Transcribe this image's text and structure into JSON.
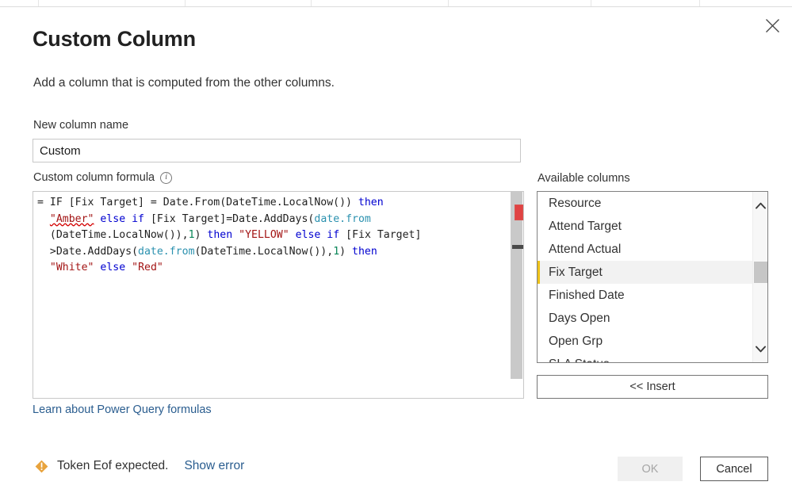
{
  "dialog": {
    "title": "Custom Column",
    "subtitle": "Add a column that is computed from the other columns.",
    "close_icon": "close-icon"
  },
  "new_column": {
    "label": "New column name",
    "value": "Custom",
    "placeholder": ""
  },
  "formula": {
    "label": "Custom column formula",
    "info_icon": "info-icon",
    "info_glyph": "i",
    "text": "= IF [Fix Target] = Date.From(DateTime.LocalNow()) then \"Amber\" else if [Fix Target]=Date.AddDays(date.from(DateTime.LocalNow()),1) then \"YELLOW\" else if [Fix Target]>Date.AddDays(date.from(DateTime.LocalNow()),1) then \"White\" else \"Red\"",
    "tokens": [
      {
        "t": "= IF [Fix Target] = Date.From(DateTime.LocalNow()) ",
        "c": "tok-fn"
      },
      {
        "t": "then",
        "c": "tok-kw"
      },
      {
        "t": "\n  ",
        "c": "tok-fn"
      },
      {
        "t": "\"Amber\"",
        "c": "tok-str misspell"
      },
      {
        "t": " ",
        "c": "tok-fn"
      },
      {
        "t": "else if",
        "c": "tok-kw"
      },
      {
        "t": " [Fix Target]=Date.AddDays(",
        "c": "tok-fn"
      },
      {
        "t": "date.from",
        "c": "tok-id"
      },
      {
        "t": "\n  (DateTime.LocalNow()),",
        "c": "tok-fn"
      },
      {
        "t": "1",
        "c": "tok-num"
      },
      {
        "t": ") ",
        "c": "tok-fn"
      },
      {
        "t": "then",
        "c": "tok-kw"
      },
      {
        "t": " ",
        "c": "tok-fn"
      },
      {
        "t": "\"YELLOW\"",
        "c": "tok-str"
      },
      {
        "t": " ",
        "c": "tok-fn"
      },
      {
        "t": "else if",
        "c": "tok-kw"
      },
      {
        "t": " [Fix Target]\n  >Date.AddDays(",
        "c": "tok-fn"
      },
      {
        "t": "date.from",
        "c": "tok-id"
      },
      {
        "t": "(DateTime.LocalNow()),",
        "c": "tok-fn"
      },
      {
        "t": "1",
        "c": "tok-num"
      },
      {
        "t": ") ",
        "c": "tok-fn"
      },
      {
        "t": "then",
        "c": "tok-kw"
      },
      {
        "t": "\n  ",
        "c": "tok-fn"
      },
      {
        "t": "\"White\"",
        "c": "tok-str"
      },
      {
        "t": " ",
        "c": "tok-fn"
      },
      {
        "t": "else",
        "c": "tok-kw"
      },
      {
        "t": " ",
        "c": "tok-fn"
      },
      {
        "t": "\"Red\"",
        "c": "tok-str"
      }
    ],
    "scrollbar": {
      "error_marker_color": "#e04343",
      "track_color": "#c9c9c9",
      "thumb_color": "#4a4a4a"
    }
  },
  "learn_link": {
    "label": "Learn about Power Query formulas",
    "color": "#2a5d8f"
  },
  "available_columns": {
    "label": "Available columns",
    "items": [
      {
        "label": "Resource",
        "selected": false
      },
      {
        "label": "Attend Target",
        "selected": false
      },
      {
        "label": "Attend Actual",
        "selected": false
      },
      {
        "label": "Fix Target",
        "selected": true
      },
      {
        "label": "Finished Date",
        "selected": false
      },
      {
        "label": "Days Open",
        "selected": false
      },
      {
        "label": "Open Grp",
        "selected": false
      },
      {
        "label": "SLA Status",
        "selected": false
      }
    ],
    "selection_accent_color": "#eec218",
    "scroll_up_icon": "chevron-up-icon",
    "scroll_down_icon": "chevron-down-icon"
  },
  "insert_button": {
    "label": "<< Insert"
  },
  "footer": {
    "warning_icon": "warning-diamond-icon",
    "warning_color": "#e8a33d",
    "error_text": "Token Eof expected.",
    "show_error_label": "Show error",
    "show_error_color": "#2a5d8f",
    "ok_label": "OK",
    "ok_enabled": false,
    "cancel_label": "Cancel"
  }
}
